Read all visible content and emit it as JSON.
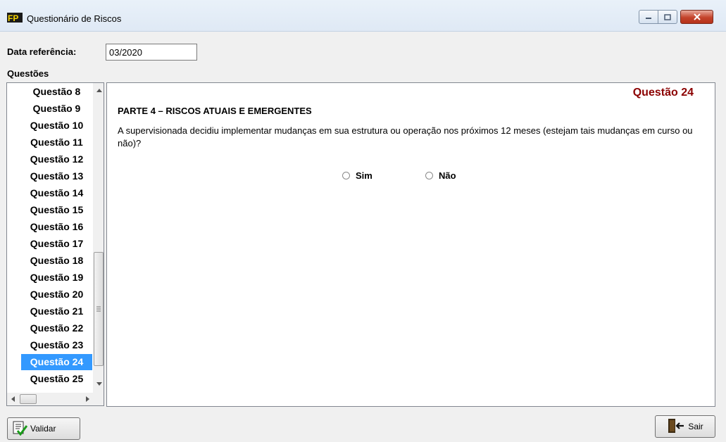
{
  "window": {
    "title": "Questionário de Riscos",
    "icon": "app-logo-icon",
    "controls": [
      "minimize-icon",
      "maximize-icon",
      "close-icon"
    ]
  },
  "form": {
    "data_referencia_label": "Data referência:",
    "data_referencia_value": "03/2020",
    "questoes_label": "Questões"
  },
  "question_list": {
    "items": [
      "Questão 8",
      "Questão 9",
      "Questão 10",
      "Questão 11",
      "Questão 12",
      "Questão 13",
      "Questão 14",
      "Questão 15",
      "Questão 16",
      "Questão 17",
      "Questão 18",
      "Questão 19",
      "Questão 20",
      "Questão 21",
      "Questão 22",
      "Questão 23",
      "Questão 24",
      "Questão 25"
    ],
    "selected": "Questão 24"
  },
  "question": {
    "number_title": "Questão 24",
    "section": "PARTE 4 – RISCOS ATUAIS E EMERGENTES",
    "text": "A supervisionada decidiu implementar mudanças em sua estrutura ou operação nos próximos 12 meses (estejam tais mudanças em curso ou não)?",
    "options": [
      "Sim",
      "Não"
    ]
  },
  "buttons": {
    "validar": "Validar",
    "sair": "Sair"
  },
  "colors": {
    "selection": "#3399ff",
    "question_title": "#8b0000"
  }
}
